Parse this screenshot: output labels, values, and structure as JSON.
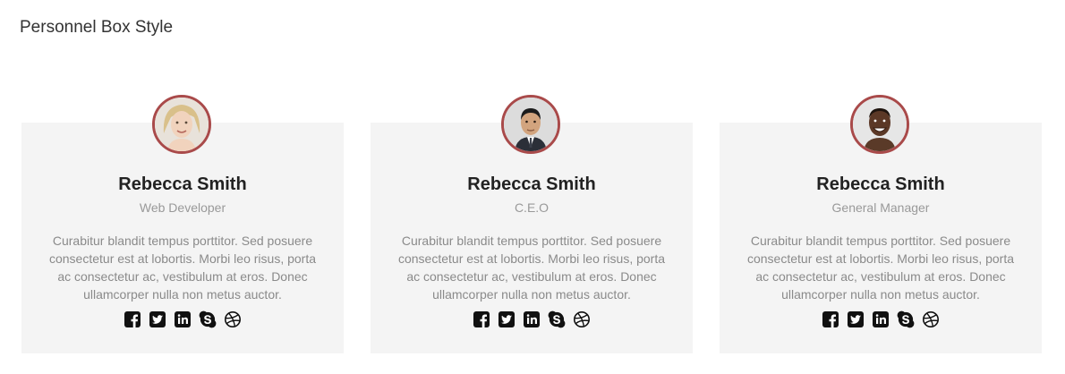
{
  "page": {
    "title": "Personnel Box Style"
  },
  "colors": {
    "card_bg": "#f4f4f4",
    "avatar_border": "#a94a4a",
    "name": "#222222",
    "muted": "#999999"
  },
  "social_icons": [
    "facebook-icon",
    "twitter-icon",
    "linkedin-icon",
    "skype-icon",
    "dribbble-icon"
  ],
  "cards": [
    {
      "avatar": "avatar-woman-blonde",
      "name": "Rebecca Smith",
      "role": "Web Developer",
      "bio": "Curabitur blandit tempus porttitor. Sed posuere consectetur est at lobortis. Morbi leo risus, porta ac consectetur ac, vestibulum at eros. Donec ullamcorper nulla non metus auctor."
    },
    {
      "avatar": "avatar-man-suit",
      "name": "Rebecca Smith",
      "role": "C.E.O",
      "bio": "Curabitur blandit tempus porttitor. Sed posuere consectetur est at lobortis. Morbi leo risus, porta ac consectetur ac, vestibulum at eros. Donec ullamcorper nulla non metus auctor."
    },
    {
      "avatar": "avatar-man-smiling",
      "name": "Rebecca Smith",
      "role": "General Manager",
      "bio": "Curabitur blandit tempus porttitor. Sed posuere consectetur est at lobortis. Morbi leo risus, porta ac consectetur ac, vestibulum at eros. Donec ullamcorper nulla non metus auctor."
    }
  ]
}
